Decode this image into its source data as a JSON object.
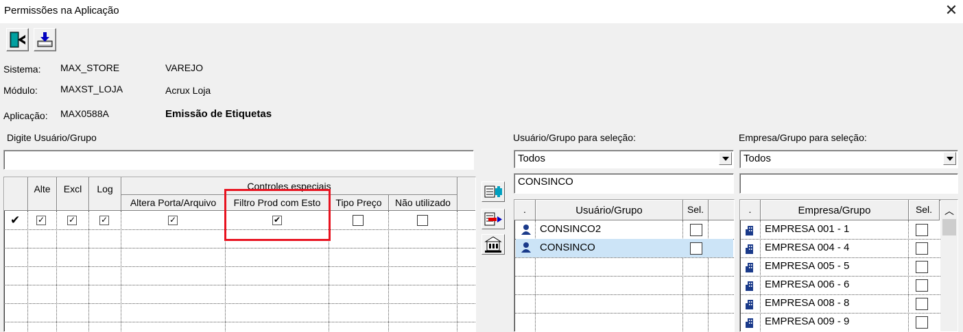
{
  "window": {
    "title": "Permissões na Aplicação",
    "close_glyph": "✕"
  },
  "toolbar": {
    "buttons": [
      {
        "name": "exit-door-icon"
      },
      {
        "name": "save-download-icon"
      }
    ]
  },
  "info": {
    "sistema_label": "Sistema:",
    "sistema_code": "MAX_STORE",
    "sistema_desc": "VAREJO",
    "modulo_label": "Módulo:",
    "modulo_code": "MAXST_LOJA",
    "modulo_desc": "Acrux Loja",
    "aplicacao_label": "Aplicação:",
    "aplicacao_code": "MAX0588A",
    "aplicacao_desc": "Emissão de Etiquetas"
  },
  "user_search": {
    "label": "Digite Usuário/Grupo",
    "value": ""
  },
  "perm_grid": {
    "headers": {
      "alte": "Alte",
      "excl": "Excl",
      "log": "Log",
      "group": "Controles especiais",
      "altera_porta": "Altera Porta/Arquivo",
      "filtro_prod": "Filtro Prod com Esto",
      "tipo_preco": "Tipo Preço",
      "nao_utilizado": "Não utilizado"
    },
    "row_marker": "✔",
    "checks": {
      "alte": true,
      "excl": true,
      "log": true,
      "altera_porta": true,
      "filtro_prod": true,
      "tipo_preco": false,
      "nao_utilizado": false
    },
    "highlight_color": "#e8121f"
  },
  "user_panel": {
    "label": "Usuário/Grupo para seleção:",
    "combo_value": "Todos",
    "filter_value": "CONSINCO",
    "headers": {
      "dot": ".",
      "name": "Usuário/Grupo",
      "sel": "Sel."
    },
    "rows": [
      {
        "name": "CONSINCO2",
        "selected_row": false,
        "checked": false
      },
      {
        "name": "CONSINCO",
        "selected_row": true,
        "checked": false
      }
    ],
    "selected_color": "#cce4f7"
  },
  "company_panel": {
    "label": "Empresa/Grupo para seleção:",
    "combo_value": "Todos",
    "filter_value": "",
    "headers": {
      "dot": ".",
      "name": "Empresa/Grupo",
      "sel": "Sel."
    },
    "rows": [
      {
        "name": "EMPRESA 001 - 1",
        "checked": false
      },
      {
        "name": "EMPRESA 004 - 4",
        "checked": false
      },
      {
        "name": "EMPRESA 005 - 5",
        "checked": false
      },
      {
        "name": "EMPRESA 006 - 6",
        "checked": false
      },
      {
        "name": "EMPRESA 008 - 8",
        "checked": false
      },
      {
        "name": "EMPRESA 009 - 9",
        "checked": false
      }
    ]
  },
  "scroll_up_glyph": "︿"
}
